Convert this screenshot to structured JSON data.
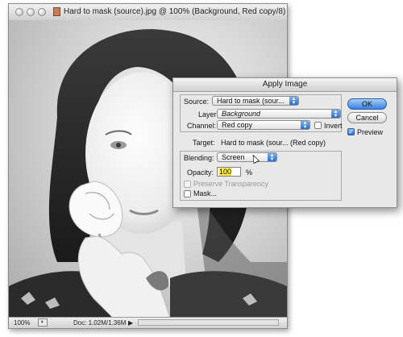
{
  "document_window": {
    "title": "Hard to mask (source).jpg @ 100% (Background, Red copy/8)",
    "zoom": "100%",
    "doc_size": "Doc: 1.02M/1.36M"
  },
  "dialog": {
    "title": "Apply Image",
    "source_label": "Source:",
    "source_value": "Hard to mask (sour...",
    "layer_label": "Layer:",
    "layer_value": "Background",
    "channel_label": "Channel:",
    "channel_value": "Red copy",
    "invert_label": "Invert",
    "invert_checked": false,
    "target_label": "Target:",
    "target_value": "Hard to mask (sour... (Red copy)",
    "blending_label": "Blending:",
    "blending_value": "Screen",
    "opacity_label": "Opacity:",
    "opacity_value": "100",
    "opacity_unit": "%",
    "preserve_transparency_label": "Preserve Transparency",
    "preserve_transparency_checked": false,
    "mask_label": "Mask...",
    "mask_checked": false,
    "ok_label": "OK",
    "cancel_label": "Cancel",
    "preview_label": "Preview",
    "preview_checked": true
  },
  "icons": {
    "window_controls": [
      "close-icon",
      "minimize-icon",
      "zoom-icon"
    ],
    "file_icon": "jpeg-file-icon",
    "popup_arrows": "up-down-arrows-icon",
    "cursor": "mouse-pointer-icon"
  },
  "colors": {
    "accent_blue": "#3a81e0",
    "opacity_highlight": "#ffe94a",
    "dialog_bg": "#e8e8e8"
  }
}
